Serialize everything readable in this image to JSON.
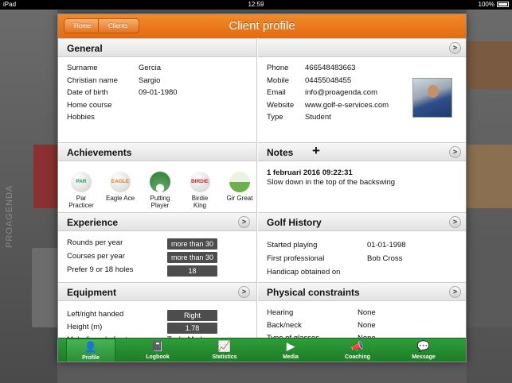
{
  "status": {
    "carrier": "iPad",
    "wifi_icon": "wifi-icon",
    "time": "12:59",
    "battery": "100%"
  },
  "background": {
    "brand_text": "PROAGENDA"
  },
  "navbar": {
    "title": "Client profile",
    "home": "Home",
    "clients": "Clients"
  },
  "general": {
    "header": "General",
    "left": [
      {
        "k": "Surname",
        "v": "Gercia"
      },
      {
        "k": "Christian name",
        "v": "Sargio"
      },
      {
        "k": "Date of birth",
        "v": "09-01-1980"
      },
      {
        "k": "Home course",
        "v": ""
      },
      {
        "k": "Hobbies",
        "v": ""
      }
    ],
    "right": [
      {
        "k": "Phone",
        "v": "466548483663"
      },
      {
        "k": "Mobile",
        "v": "04455048455"
      },
      {
        "k": "Email",
        "v": "info@proagenda.com"
      },
      {
        "k": "Website",
        "v": "www.golf-e-services.com"
      },
      {
        "k": "Type",
        "v": "Student"
      }
    ]
  },
  "achievements": {
    "header": "Achievements",
    "items": [
      {
        "ball": "PAR",
        "label1": "Par",
        "label2": "Practicer",
        "color": "#1aa04a"
      },
      {
        "ball": "EAGLE",
        "label1": "Eagle Ace",
        "label2": "",
        "color": "#e07a10"
      },
      {
        "ball": "",
        "label1": "Putting",
        "label2": "Player",
        "color": "#2a8c35"
      },
      {
        "ball": "BIRDIE",
        "label1": "Birdie",
        "label2": "King",
        "color": "#d0262a"
      },
      {
        "ball": "",
        "label1": "Gir Great",
        "label2": "",
        "color": "#6ab04c"
      }
    ]
  },
  "notes": {
    "header": "Notes",
    "add": "+",
    "time": "1 februari 2016 09:22:31",
    "text": "Slow down in the top of the backswing"
  },
  "experience": {
    "header": "Experience",
    "rows": [
      {
        "k": "Rounds per year",
        "v": "more than 30"
      },
      {
        "k": "Courses per year",
        "v": "more than 30"
      },
      {
        "k": "Prefer 9 or 18 holes",
        "v": "18"
      }
    ]
  },
  "golf_history": {
    "header": "Golf History",
    "rows": [
      {
        "k": "Started playing",
        "v": "01-01-1998"
      },
      {
        "k": "First professional",
        "v": "Bob Cross"
      },
      {
        "k": "Handicap obtained on",
        "v": ""
      }
    ]
  },
  "equipment": {
    "header": "Equipment",
    "rows": [
      {
        "k": "Left/right handed",
        "v": "Right"
      },
      {
        "k": "Height (m)",
        "v": "1.78"
      },
      {
        "k": "Make/brand of set",
        "v": "TaylorMade"
      }
    ]
  },
  "physical": {
    "header": "Physical constraints",
    "rows": [
      {
        "k": "Hearing",
        "v": "None"
      },
      {
        "k": "Back/neck",
        "v": "None"
      },
      {
        "k": "Type of glasses",
        "v": "None"
      }
    ]
  },
  "tabs": [
    {
      "label": "Profile",
      "icon": "person-icon",
      "glyph": "👤"
    },
    {
      "label": "Logbook",
      "icon": "logbook-icon",
      "glyph": "📓"
    },
    {
      "label": "Statistics",
      "icon": "chart-icon",
      "glyph": "📈"
    },
    {
      "label": "Media",
      "icon": "play-icon",
      "glyph": "▶"
    },
    {
      "label": "Coaching",
      "icon": "megaphone-icon",
      "glyph": "📣"
    },
    {
      "label": "Message",
      "icon": "chat-icon",
      "glyph": "💬"
    }
  ],
  "colors": {
    "accent": "#e8741a",
    "tabbar": "#2a8c35"
  }
}
